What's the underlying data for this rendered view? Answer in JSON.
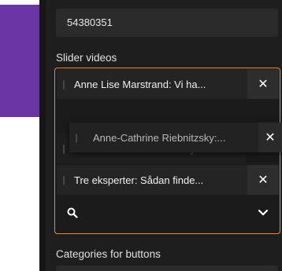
{
  "id_field": {
    "value": "54380351"
  },
  "slider_videos": {
    "label": "Slider videos",
    "items": [
      {
        "title": "Anne Lise Marstrand: Vi ha..."
      },
      {
        "title": "Anne-Cathrine Riebnitzsky:..."
      },
      {
        "title": "Tre eksperter: Sådan finde..."
      }
    ],
    "dragging_item": {
      "title": "Anne-Cathrine Riebnitzsky:..."
    },
    "search_placeholder": ""
  },
  "categories": {
    "label": "Categories for buttons"
  },
  "colors": {
    "accent": "#f08a24",
    "purple": "#6b35a6",
    "panel_bg": "#1e1e1e"
  }
}
